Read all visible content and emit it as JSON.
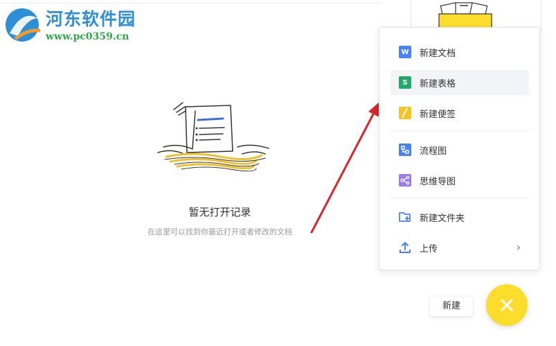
{
  "watermark": {
    "title": "河东软件园",
    "url": "www.pc0359.cn"
  },
  "empty_state": {
    "title": "暂无打开记录",
    "description": "在这里可以找到你最近打开或者修改的文档"
  },
  "menu": {
    "items": [
      {
        "label": "新建文档",
        "icon": "word-doc-icon",
        "badge": "W",
        "color": "#4a82f4"
      },
      {
        "label": "新建表格",
        "icon": "sheet-icon",
        "badge": "S",
        "color": "#23a86a"
      },
      {
        "label": "新建便签",
        "icon": "note-icon",
        "badge": "",
        "color": "#f5c527"
      },
      {
        "label": "流程图",
        "icon": "flowchart-icon",
        "badge": "",
        "color": "#4a82f4"
      },
      {
        "label": "思维导图",
        "icon": "mindmap-icon",
        "badge": "",
        "color": "#9a7cf0"
      },
      {
        "label": "新建文件夹",
        "icon": "new-folder-icon",
        "badge": "",
        "color": "#4a82f4"
      },
      {
        "label": "上传",
        "icon": "upload-icon",
        "badge": "",
        "color": "#4a82f4",
        "chevron": "›"
      }
    ]
  },
  "new_button": {
    "label": "新建"
  },
  "fab": {
    "icon": "close-icon",
    "symbol": "×",
    "color": "#fddd2c"
  },
  "colors": {
    "accent_yellow": "#fddd2c",
    "arrow_red": "#d6262b",
    "watermark_blue": "#2e8fd6",
    "watermark_green": "#2ea84a"
  }
}
